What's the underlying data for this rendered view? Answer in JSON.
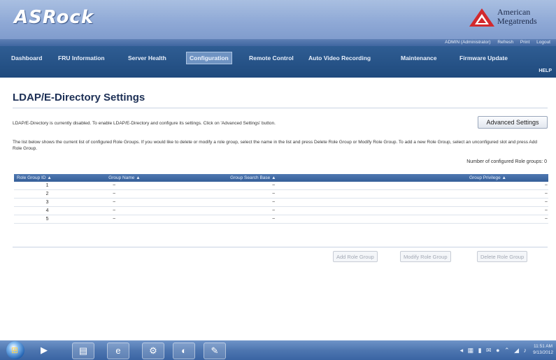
{
  "header": {
    "brand": "ASRock",
    "ami_line1": "American",
    "ami_line2": "Megatrends",
    "links": [
      "ADMIN (Administrator)",
      "Refresh",
      "Print",
      "Logout"
    ]
  },
  "nav": {
    "tabs": [
      "Dashboard",
      "FRU Information",
      "Server Health",
      "Configuration",
      "Remote Control",
      "Auto Video Recording",
      "Maintenance",
      "Firmware Update"
    ],
    "active": "Configuration",
    "help": "HELP"
  },
  "page": {
    "title": "LDAP/E-Directory Settings",
    "status_text": "LDAP/E-Directory is currently disabled. To enable LDAP/E-Directory and configure its settings. Click on 'Advanced Settings' button.",
    "advanced_button": "Advanced Settings",
    "description": "The list below shows the current list of configured Role Groups. If you would like to delete or modify a role group, select the name in the list and press Delete Role Group or Modify Role Group. To add a new Role Group, select an unconfigured slot and press Add Role Group.",
    "count_label": "Number of configured Role groups: 0"
  },
  "table": {
    "headers": [
      "Role Group ID",
      "Group Name",
      "Group Search Base",
      "Group Privilege"
    ],
    "rows": [
      [
        "1",
        "~",
        "~",
        "~"
      ],
      [
        "2",
        "~",
        "~",
        "~"
      ],
      [
        "3",
        "~",
        "~",
        "~"
      ],
      [
        "4",
        "~",
        "~",
        "~"
      ],
      [
        "5",
        "~",
        "~",
        "~"
      ]
    ]
  },
  "actions": {
    "add": "Add Role Group",
    "modify": "Modify Role Group",
    "delete": "Delete Role Group"
  },
  "taskbar": {
    "clock_time": "11:51 AM",
    "clock_date": "9/13/2012"
  },
  "colors": {
    "header_bg": "#8fa9d6",
    "nav_bg": "#1f4a7d",
    "table_header_bg": "#355f99",
    "title_color": "#1c2f55"
  }
}
